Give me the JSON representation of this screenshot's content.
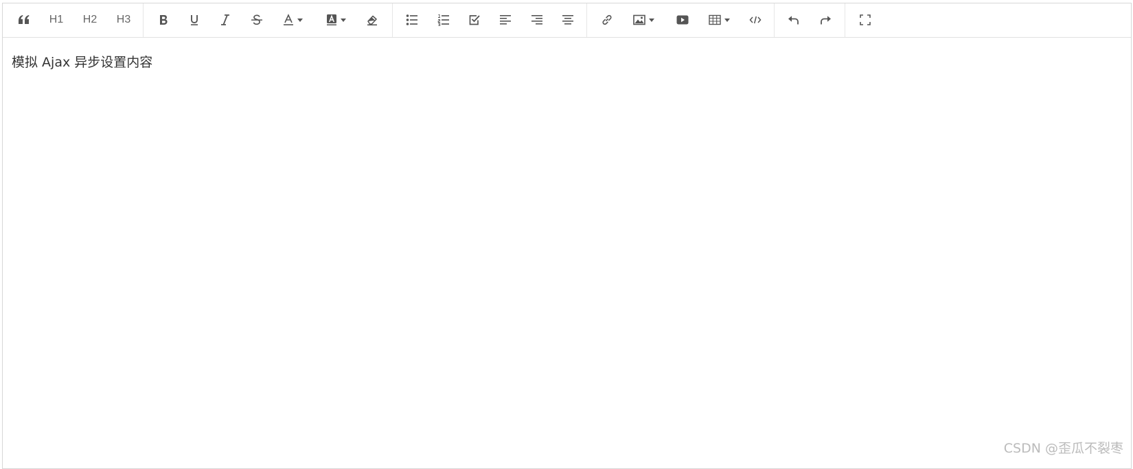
{
  "toolbar": {
    "h1_label": "H1",
    "h2_label": "H2",
    "h3_label": "H3",
    "icons": [
      "quote-icon",
      "bold-icon",
      "underline-icon",
      "italic-icon",
      "strikethrough-icon",
      "font-color-icon",
      "background-color-icon",
      "eraser-icon",
      "bulleted-list-icon",
      "numbered-list-icon",
      "todo-icon",
      "align-left-icon",
      "align-right-icon",
      "align-center-icon",
      "link-icon",
      "image-icon",
      "video-icon",
      "table-icon",
      "code-icon",
      "undo-icon",
      "redo-icon",
      "fullscreen-icon"
    ]
  },
  "editor": {
    "content": "模拟 Ajax 异步设置内容"
  },
  "watermark": "CSDN @歪瓜不裂枣",
  "colors": {
    "icon": "#555555",
    "border": "#d6d6d6",
    "text": "#333333",
    "watermark": "#bbbbbb"
  }
}
